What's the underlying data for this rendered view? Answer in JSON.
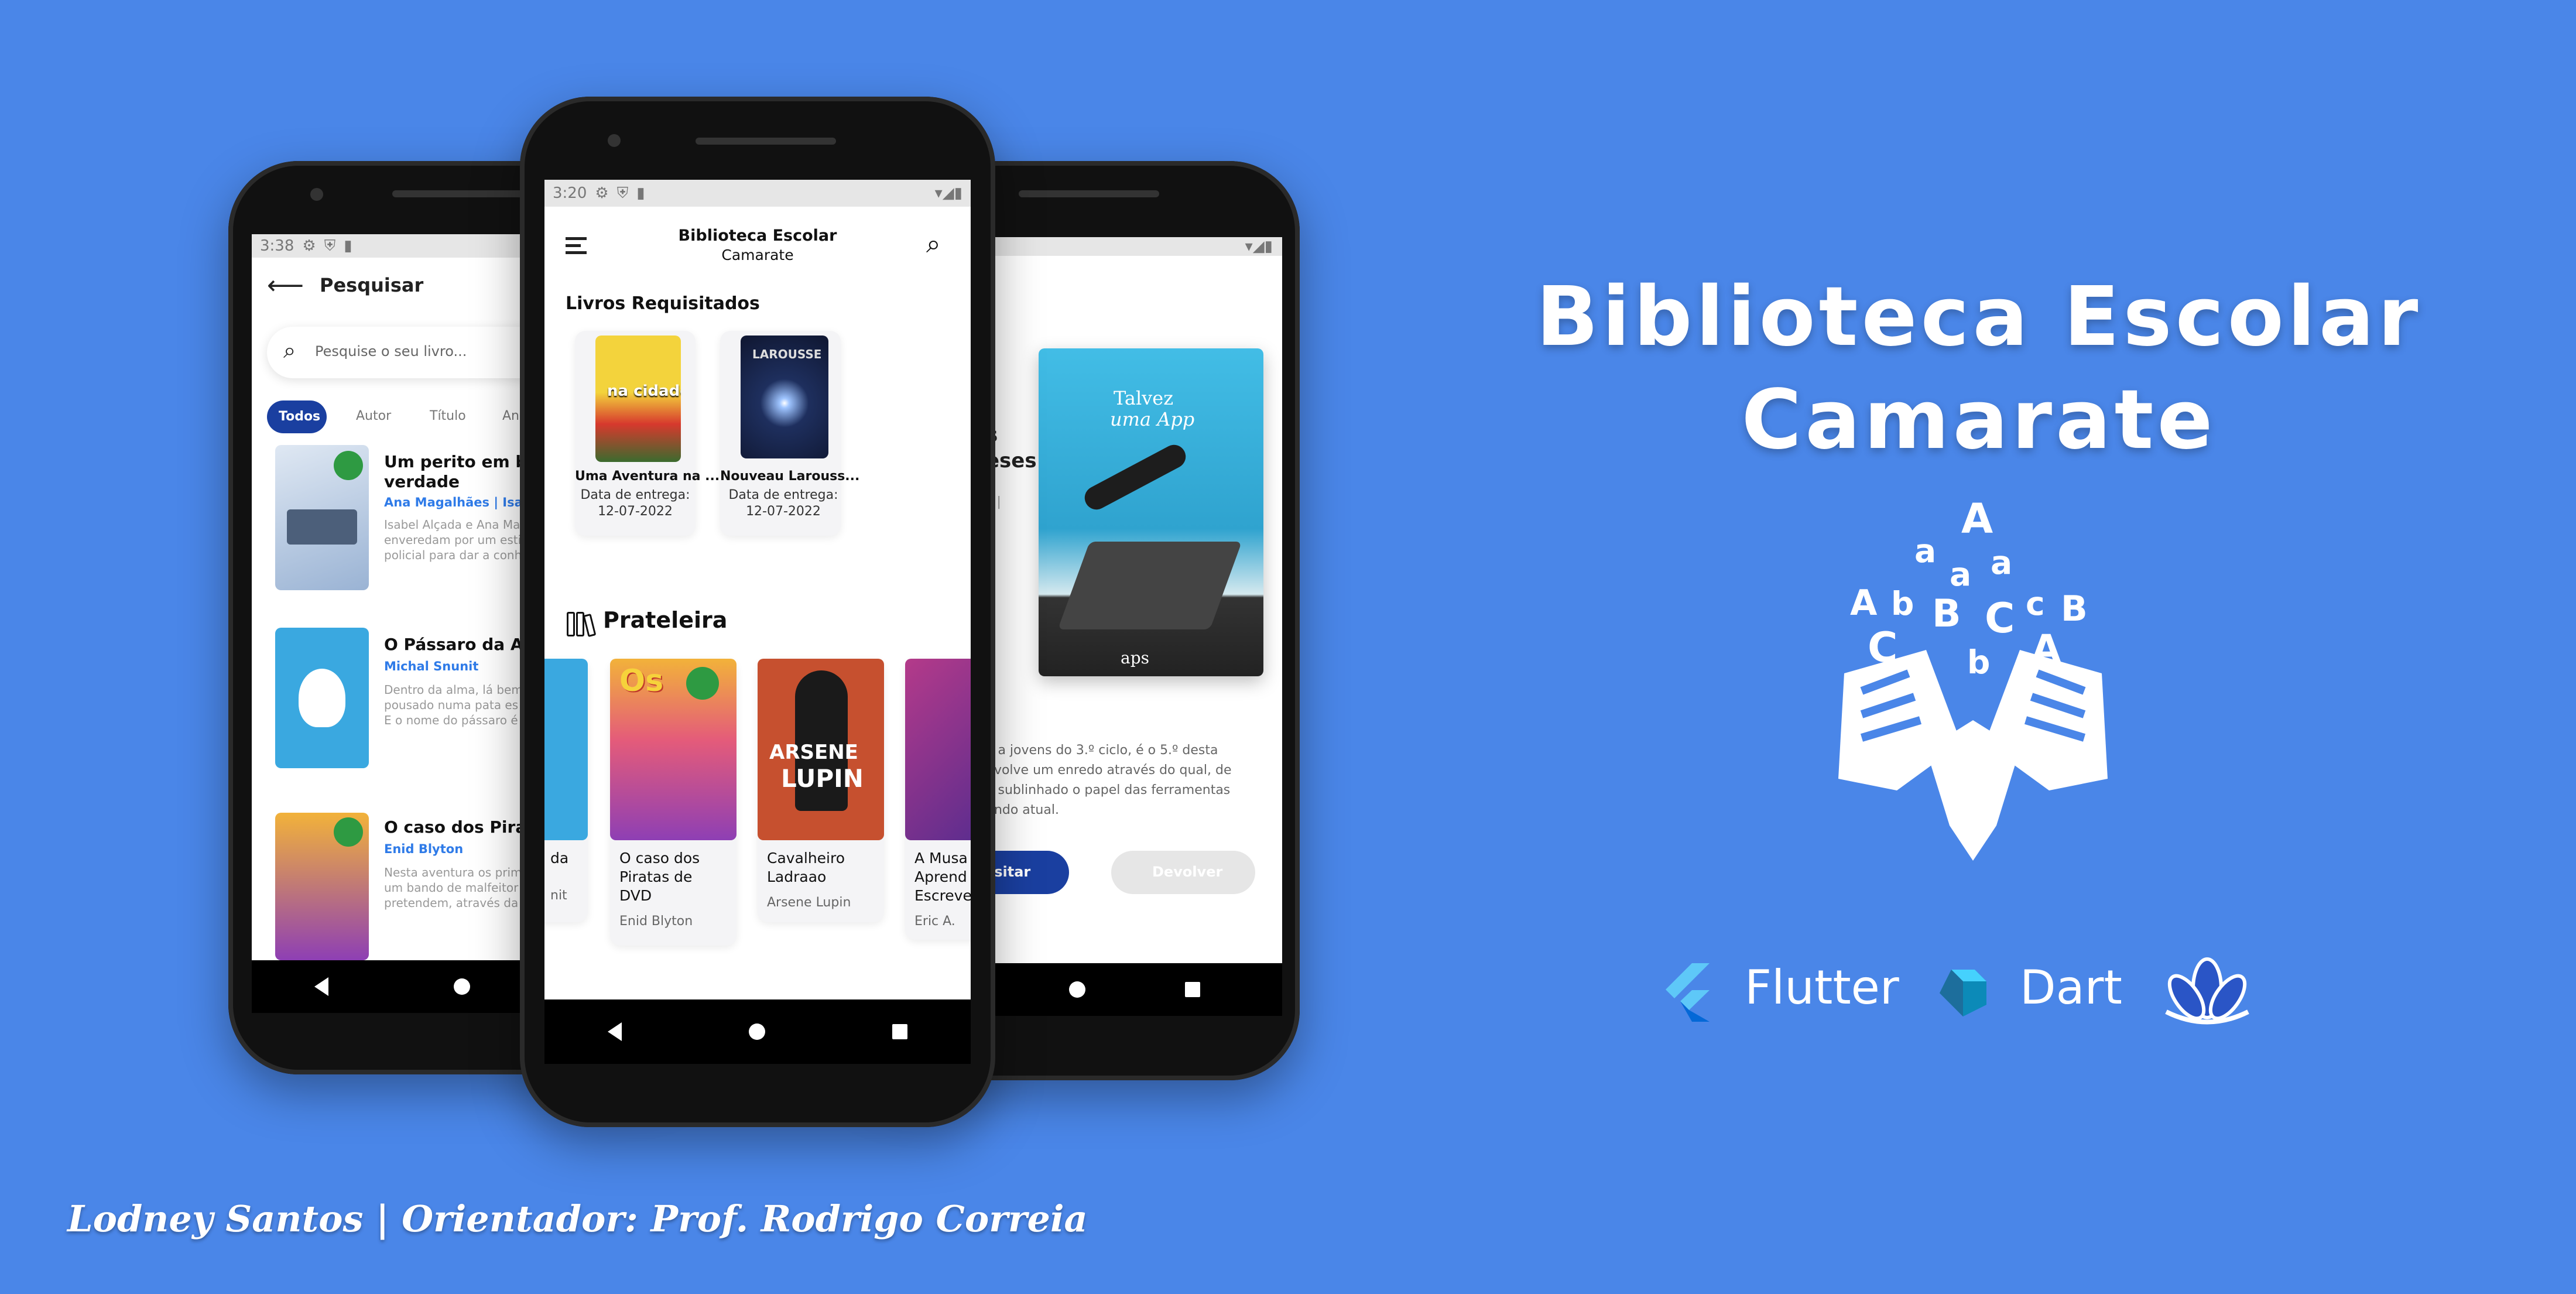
{
  "brand": {
    "title_line1": "Biblioteca Escolar",
    "title_line2": "Camarate",
    "credit": "Lodney Santos | Orientador: Prof. Rodrigo Correia",
    "tech": [
      {
        "name": "Flutter",
        "icon": "flutter-icon"
      },
      {
        "name": "Dart",
        "icon": "dart-icon"
      },
      {
        "name": "",
        "icon": "lotus-icon"
      }
    ],
    "colors": {
      "background": "#4a86e8",
      "accent": "#1a3fa0",
      "white": "#ffffff"
    }
  },
  "left_phone": {
    "status_time": "3:38",
    "header_title": "Pesquisar",
    "search_placeholder": "Pesquise o seu livro...",
    "filters": [
      "Todos",
      "Autor",
      "Título",
      "An"
    ],
    "results": [
      {
        "title_l1": "Um perito em busc",
        "title_l2": "verdade",
        "author": "Ana Magalhães | Isab",
        "desc_l1": "Isabel Alçada e Ana Ma",
        "desc_l2": "enveredam por um estil",
        "desc_l3": "policial para dar a conh"
      },
      {
        "title_l1": "O Pássaro da Alm",
        "title_l2": "",
        "author": "Michal Snunit",
        "desc_l1": "Dentro da alma, lá bem",
        "desc_l2": "pousado numa pata es",
        "desc_l3": "E o nome do pássaro é"
      },
      {
        "title_l1": "O caso dos Piratas",
        "title_l2": "",
        "author": "Enid Blyton",
        "desc_l1": "Nesta aventura os prim",
        "desc_l2": "um bando de malfeitor",
        "desc_l3": "pretendem, através da"
      }
    ]
  },
  "center_phone": {
    "status_time": "3:20",
    "app_title": "Biblioteca Escolar",
    "app_subtitle": "Camarate",
    "section_requested": "Livros Requisitados",
    "requested": [
      {
        "title": "Uma Aventura na ...",
        "date_label": "Data de entrega:",
        "date": "12-07-2022"
      },
      {
        "title": "Nouveau Larouss...",
        "date_label": "Data de entrega:",
        "date": "12-07-2022"
      }
    ],
    "section_shelf": "Prateleira",
    "shelf": [
      {
        "title_l1": "da",
        "title_l2": "",
        "title_l3": "",
        "author": "nit"
      },
      {
        "title_l1": "O caso dos",
        "title_l2": "Piratas de",
        "title_l3": "DVD",
        "author": "Enid Blyton"
      },
      {
        "title_l1": "Cavalheiro",
        "title_l2": "Ladraao",
        "title_l3": "",
        "author": "Arsene Lupin"
      },
      {
        "title_l1": "A Musa",
        "title_l2": "Aprend",
        "title_l3": "Escreve",
        "author": "Eric A."
      }
    ]
  },
  "right_phone": {
    "partial_title_l1": "s",
    "partial_title_l2": "eses",
    "partial_meta": "s |",
    "cover_text_l1": "Talvez",
    "cover_text_l2": "uma App",
    "cover_publisher": "aps",
    "desc_l1": "o a jovens do 3.º ciclo, é o 5.º desta",
    "desc_l2": "nvolve um enredo através do qual, de",
    "desc_l3": "é sublinhado o papel das ferramentas",
    "desc_l4": "undo atual.",
    "btn_requisitar": "isitar",
    "btn_devolver": "Devolver"
  }
}
